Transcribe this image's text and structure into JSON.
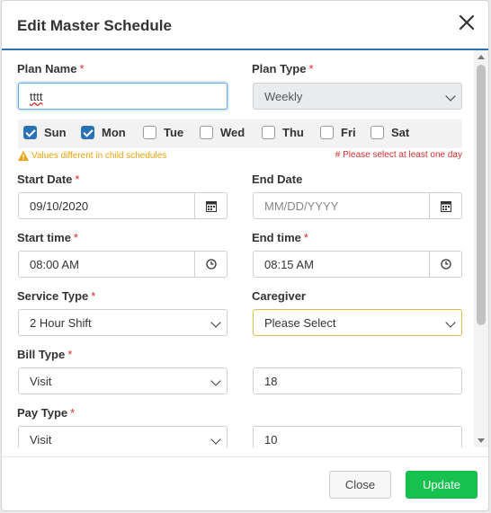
{
  "modal": {
    "title": "Edit Master Schedule"
  },
  "plan_name": {
    "label": "Plan Name",
    "required_mark": "*",
    "value": "tttt"
  },
  "plan_type": {
    "label": "Plan Type",
    "required_mark": "*",
    "value": "Weekly"
  },
  "days": [
    {
      "label": "Sun",
      "checked": true
    },
    {
      "label": "Mon",
      "checked": true
    },
    {
      "label": "Tue",
      "checked": false
    },
    {
      "label": "Wed",
      "checked": false
    },
    {
      "label": "Thu",
      "checked": false
    },
    {
      "label": "Fri",
      "checked": false
    },
    {
      "label": "Sat",
      "checked": false
    }
  ],
  "warning_text": "Values different in child schedules",
  "error_text": "# Please select at least one day",
  "start_date": {
    "label": "Start Date",
    "required_mark": "*",
    "value": "09/10/2020"
  },
  "end_date": {
    "label": "End Date",
    "placeholder": "MM/DD/YYYY"
  },
  "start_time": {
    "label": "Start time",
    "required_mark": "*",
    "value": "08:00 AM"
  },
  "end_time": {
    "label": "End time",
    "required_mark": "*",
    "value": "08:15 AM"
  },
  "service_type": {
    "label": "Service Type",
    "required_mark": "*",
    "value": "2 Hour Shift"
  },
  "caregiver": {
    "label": "Caregiver",
    "value": "Please Select"
  },
  "bill_type": {
    "label": "Bill Type",
    "required_mark": "*",
    "value": "Visit",
    "amount": "18"
  },
  "pay_type": {
    "label": "Pay Type",
    "required_mark": "*",
    "value": "Visit",
    "amount": "10"
  },
  "footer": {
    "close_label": "Close",
    "update_label": "Update"
  },
  "colors": {
    "primary": "#2a72b5",
    "success": "#16c24d",
    "warning": "#e7a20b",
    "danger": "#d62d2d"
  }
}
